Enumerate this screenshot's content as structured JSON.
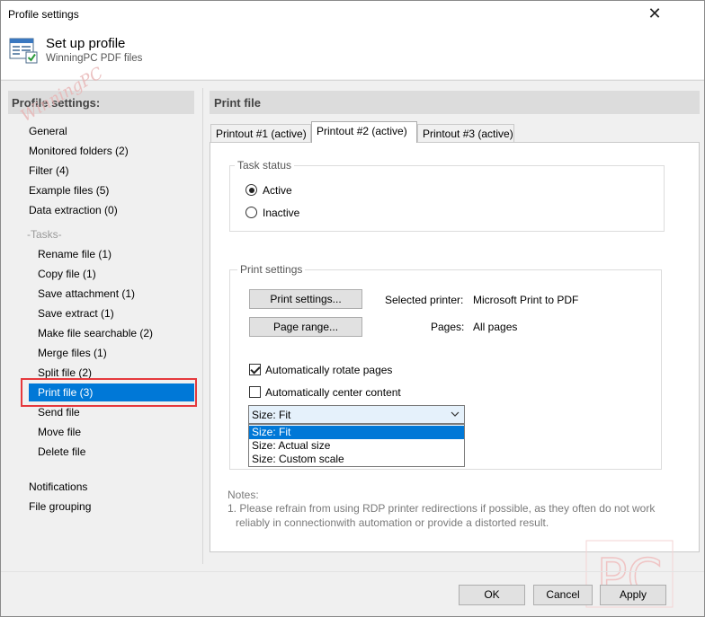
{
  "window": {
    "title": "Profile settings",
    "close_glyph": "✕"
  },
  "header": {
    "title": "Set up profile",
    "subtitle": "WinningPC PDF files",
    "icon": "window-settings-icon"
  },
  "watermark_text": "WinningPC",
  "nav": {
    "heading": "Profile settings:",
    "items": [
      {
        "label": "General"
      },
      {
        "label": "Monitored folders (2)"
      },
      {
        "label": "Filter (4)"
      },
      {
        "label": "Example files (5)"
      },
      {
        "label": "Data extraction (0)"
      },
      {
        "label": "-Tasks-"
      },
      {
        "label": "Rename file (1)"
      },
      {
        "label": "Copy file (1)"
      },
      {
        "label": "Save attachment (1)"
      },
      {
        "label": "Save extract (1)"
      },
      {
        "label": "Make file searchable (2)"
      },
      {
        "label": "Merge files (1)"
      },
      {
        "label": "Split file (2)"
      },
      {
        "label": "Print file (3)"
      },
      {
        "label": "Send file"
      },
      {
        "label": "Move file"
      },
      {
        "label": "Delete file"
      },
      {
        "label": "Notifications"
      },
      {
        "label": "File grouping"
      }
    ],
    "selected": "Print file (3)",
    "selection_color": "#0078d7",
    "highlight_color": "#e5393d"
  },
  "panel": {
    "heading": "Print file",
    "tabs": [
      {
        "label": "Printout #1 (active)"
      },
      {
        "label": "Printout #2 (active)"
      },
      {
        "label": "Printout #3 (active)"
      }
    ],
    "active_tab": "Printout #2 (active)",
    "task_status": {
      "legend": "Task status",
      "options": [
        {
          "label": "Active",
          "checked": true
        },
        {
          "label": "Inactive",
          "checked": false
        }
      ]
    },
    "print_settings": {
      "legend": "Print settings",
      "print_settings_button": "Print settings...",
      "page_range_button": "Page range...",
      "selected_printer_label": "Selected printer:",
      "selected_printer_value": "Microsoft Print to PDF",
      "pages_label": "Pages:",
      "pages_value": "All pages",
      "auto_rotate": {
        "label": "Automatically rotate pages",
        "checked": true
      },
      "auto_center": {
        "label": "Automatically center content",
        "checked": false
      },
      "size_select": {
        "value": "Size: Fit",
        "options": [
          "Size: Fit",
          "Size: Actual size",
          "Size: Custom scale"
        ]
      }
    },
    "notes": {
      "heading": "Notes:",
      "line1": "1. Please refrain from using RDP printer redirections if possible, as they often do not work",
      "line2": "reliably in connectionwith automation or provide a distorted result."
    }
  },
  "logo_text": "PC",
  "buttons": {
    "ok": "OK",
    "cancel": "Cancel",
    "apply": "Apply"
  }
}
